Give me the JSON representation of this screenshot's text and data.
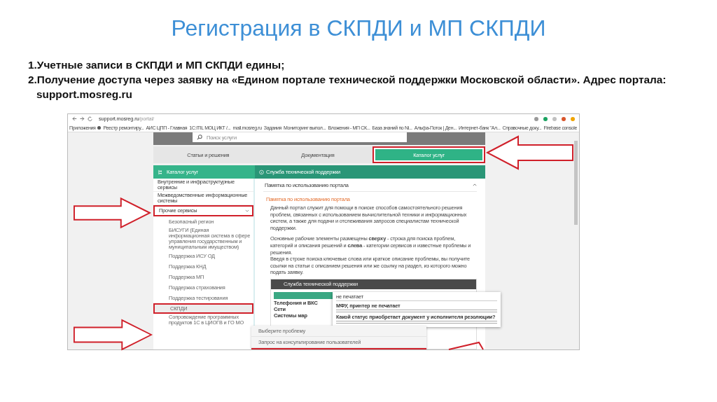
{
  "title": "Регистрация в СКПДИ и МП СКПДИ",
  "bullets": [
    "1.Учетные записи в СКПДИ и МП СКПДИ едины;",
    "2.Получение доступа через заявку на «Едином портале технической поддержки Московской области». Адрес портала: support.mosreg.ru"
  ],
  "browser": {
    "url_host": "support.mosreg.ru",
    "url_path": "/portal/",
    "bookmarks": [
      "Приложения",
      "Реестр ремонтиру...",
      "АИС ЦПП - Главная",
      "1С:ITIL МОЦ ИКТ /...",
      "mail.mosreg.ru",
      "Задания",
      "Мониторинг выпол...",
      "Вложения - МП СК...",
      "База знаний по Ni...",
      "Альфа-Поток | Ден...",
      "Интернет-банк \"Ал...",
      "Справочные доку...",
      "Firebase console"
    ]
  },
  "portal": {
    "search_placeholder": "Поиск услуги",
    "tabs": [
      {
        "label": "Статьи и решения",
        "selected": false,
        "highlighted": false
      },
      {
        "label": "Документация",
        "selected": false,
        "highlighted": false
      },
      {
        "label": "Каталог услуг",
        "selected": true,
        "highlighted": true
      }
    ],
    "catalog_header": "Каталог услуг",
    "service_header": "Служба технической поддержки",
    "sidebar": [
      {
        "label": "Внутренние и инфраструктурные сервисы",
        "highlighted": false
      },
      {
        "label": "Межведомственные информационные системы",
        "highlighted": false
      },
      {
        "label": "Прочие сервисы",
        "highlighted": true,
        "expanded": true,
        "children": [
          {
            "label": "Безопасный регион",
            "selected": false,
            "highlighted": false
          },
          {
            "label": "БИСУГИ (Единая информационная система в сфере управления государственным и муниципальным имуществом)",
            "selected": false,
            "highlighted": false
          },
          {
            "label": "Поддержка ИСУ ОД",
            "selected": false,
            "highlighted": false
          },
          {
            "label": "Поддержка КНД",
            "selected": false,
            "highlighted": false
          },
          {
            "label": "Поддержка МП",
            "selected": false,
            "highlighted": false
          },
          {
            "label": "Поддержка страхования",
            "selected": false,
            "highlighted": false
          },
          {
            "label": "Поддержка тестирования",
            "selected": false,
            "highlighted": false
          },
          {
            "label": "СКПДИ",
            "selected": true,
            "highlighted": true
          },
          {
            "label": "Сопровождение программных продуктов 1С в ЦИОГВ и ГО МО",
            "selected": false,
            "highlighted": false
          }
        ]
      }
    ],
    "accordion": {
      "title": "Памятка по использованию портала",
      "expanded": true
    },
    "memo_link": "Памятка по использованию портала",
    "paragraphs": [
      "Данный портал служит для помощи в поиске способов самостоятельного решения проблем, связанных с использованием вычислительной техники и информационных систем, а также для подачи и отслеживания запросов специалистам технической поддержки.",
      "Основные рабочие элементы размещены **сверху** - строка для поиска проблем, категорий и описания решений и **слева** - категории сервисов и известные проблемы и решения.",
      "Введя в строке поиска ключевые слова или краткое описание проблемы, вы получите ссылки на статьи с описанием решения или же ссылку на раздел, из которого можно подать заявку."
    ],
    "embedded": {
      "header": "Служба технической поддержки",
      "search_value": "не печатает",
      "rows": [
        "Телефония и ВКС",
        "Сети",
        "Системы мар"
      ],
      "results": [
        "МФУ, принтер не печатает",
        "Какой статус приобретает документ у исполнителя резолюции?"
      ]
    },
    "dropdown": [
      "Выберите проблему",
      "Запрос на консультирование пользователей"
    ]
  }
}
